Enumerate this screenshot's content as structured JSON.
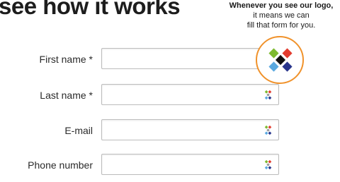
{
  "headline": "see how it works",
  "tagline": {
    "line1": "Whenever you see our logo,",
    "line2": "it means we can",
    "line3": "fill that form for you."
  },
  "form": {
    "fields": [
      {
        "label": "First name *",
        "value": ""
      },
      {
        "label": "Last name *",
        "value": ""
      },
      {
        "label": "E-mail",
        "value": ""
      },
      {
        "label": "Phone number",
        "value": ""
      }
    ]
  },
  "icons": {
    "autofill_logo": "autofill-logo-icon"
  },
  "colors": {
    "callout_ring": "#f0922b",
    "logo_green": "#7dba2f",
    "logo_red": "#e23b2e",
    "logo_blue": "#5aa9e0",
    "logo_navy": "#27348b",
    "logo_center": "#111111"
  }
}
